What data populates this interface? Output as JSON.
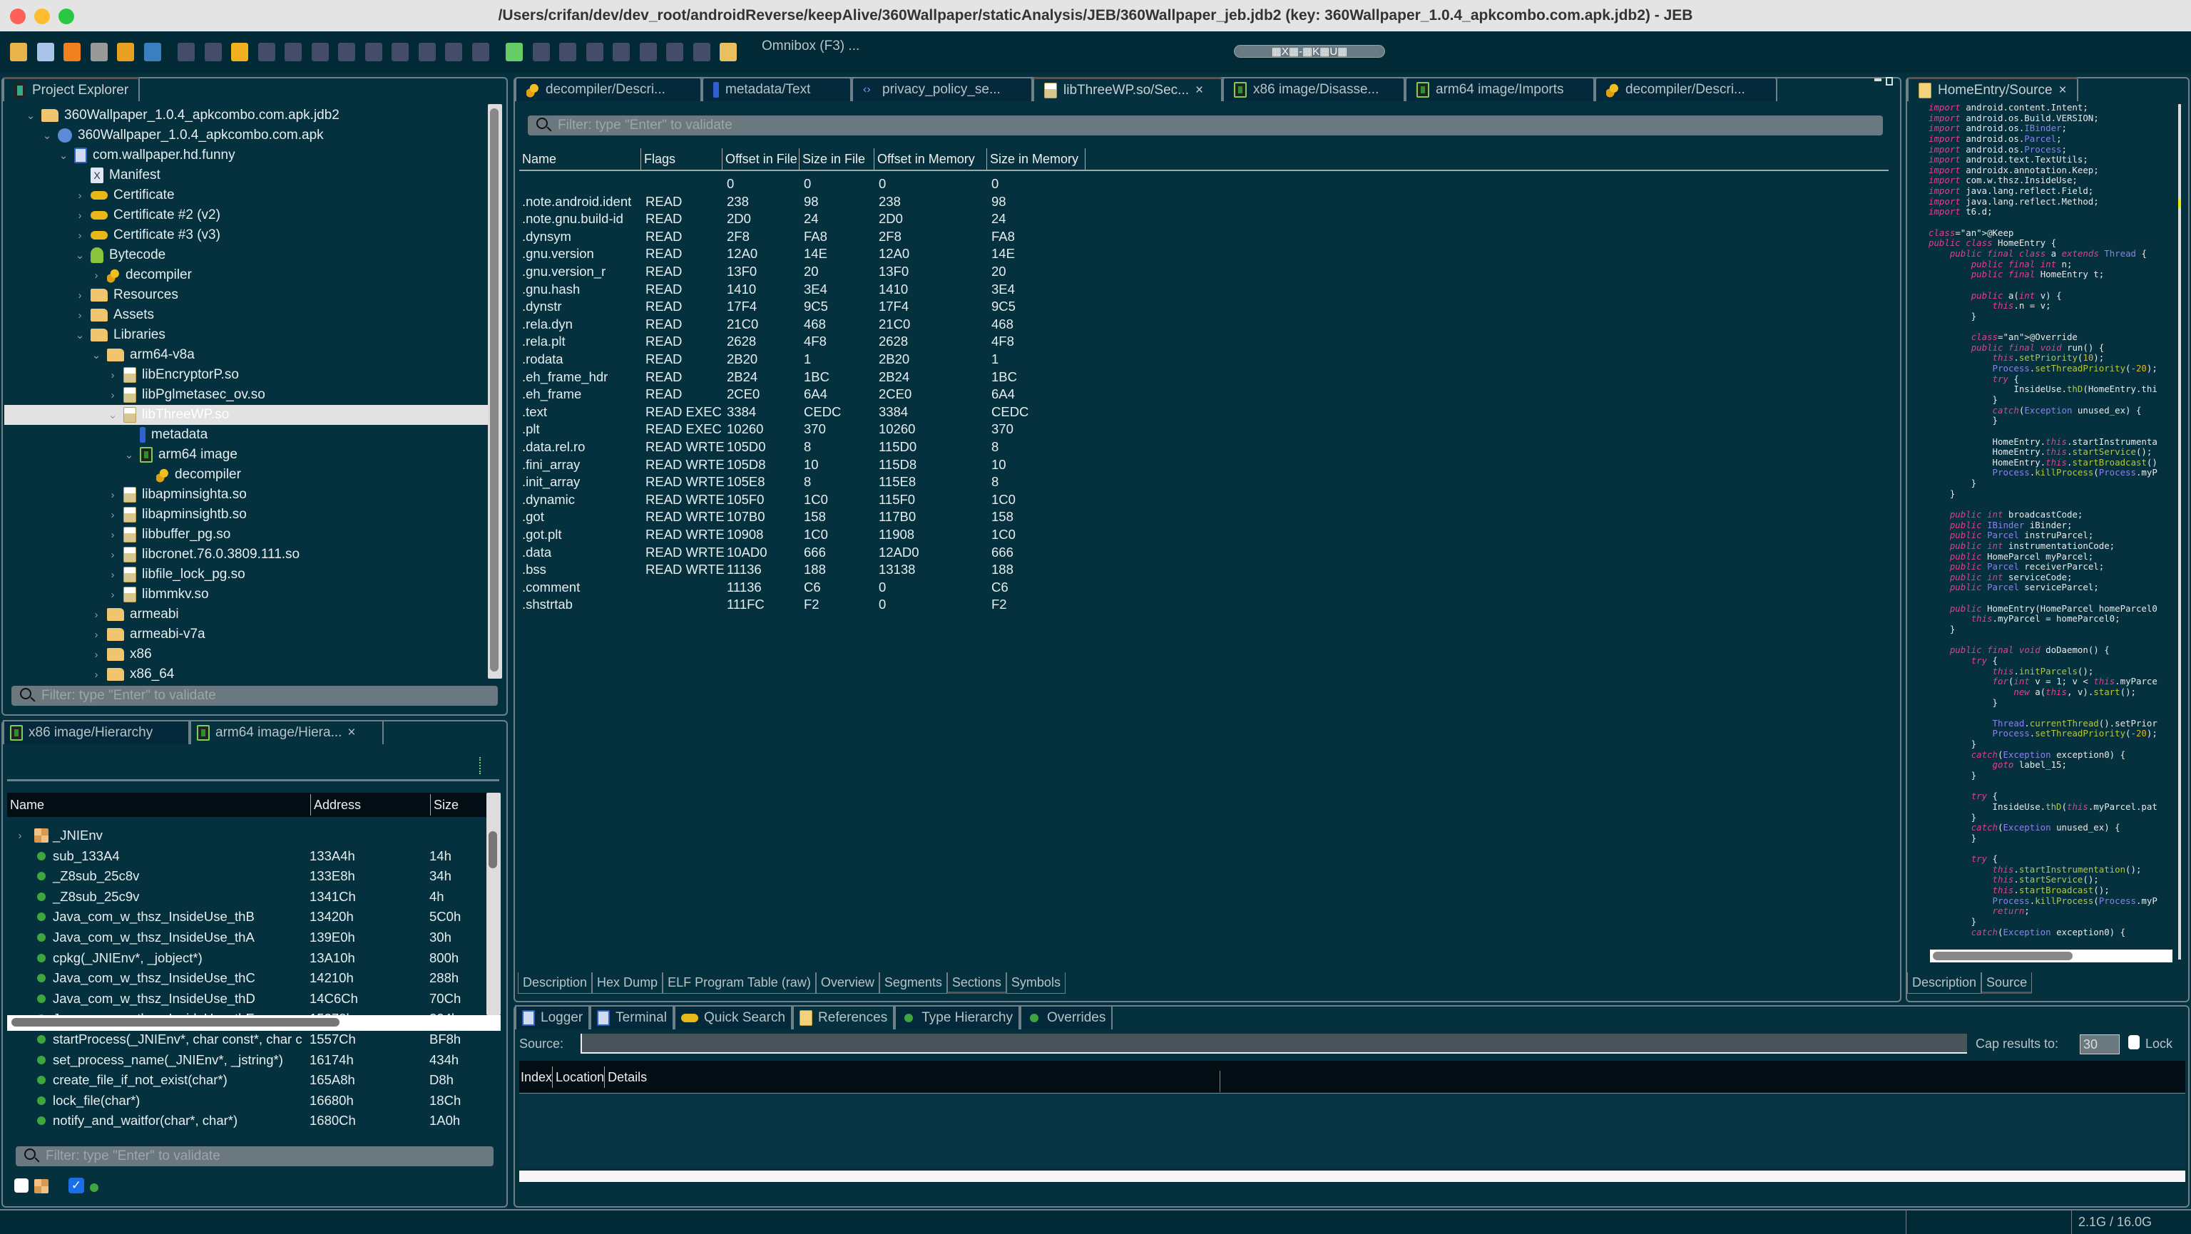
{
  "window": {
    "title": "/Users/crifan/dev/dev_root/androidReverse/keepAlive/360Wallpaper/staticAnalysis/JEB/360Wallpaper_jeb.jdb2 (key: 360Wallpaper_1.0.4_apkcombo.com.apk.jdb2) - JEB"
  },
  "toolbar": {
    "icons": [
      "open-folder-icon",
      "save-icon",
      "wrench-icon",
      "usb-icon",
      "warning-icon",
      "globe-icon",
      "step-into-icon",
      "jump-icon",
      "back-arrow-icon",
      "forward-arrow-icon",
      "gear-icon",
      "comment-icon",
      "pencil-icon",
      "export-icon",
      "grid-icon",
      "blocks-icon",
      "graph-icon",
      "overrides-icon",
      "bug-icon",
      "run-icon",
      "pause-icon",
      "stop-icon",
      "step-over-icon",
      "step-back-icon",
      "step-out-icon",
      "run-to-icon",
      "marker-icon"
    ],
    "omnibox": "Omnibox (F3) ...",
    "shortcut_badge": "▦X▦-▦K▦U▦"
  },
  "project_explorer": {
    "tab": "Project Explorer",
    "filter_placeholder": "Filter: type \"Enter\" to validate",
    "items": [
      {
        "label": "360Wallpaper_1.0.4_apkcombo.com.apk.jdb2",
        "level": 0,
        "chev": "v",
        "icon": "folder"
      },
      {
        "label": "360Wallpaper_1.0.4_apkcombo.com.apk",
        "level": 1,
        "chev": "v",
        "icon": "apk"
      },
      {
        "label": "com.wallpaper.hd.funny",
        "level": 2,
        "chev": "v",
        "icon": "pkg"
      },
      {
        "label": "Manifest",
        "level": 3,
        "chev": "",
        "icon": "manifest"
      },
      {
        "label": "Certificate",
        "level": 3,
        "chev": ">",
        "icon": "key"
      },
      {
        "label": "Certificate #2 (v2)",
        "level": 3,
        "chev": ">",
        "icon": "key"
      },
      {
        "label": "Certificate #3 (v3)",
        "level": 3,
        "chev": ">",
        "icon": "key"
      },
      {
        "label": "Bytecode",
        "level": 3,
        "chev": "v",
        "icon": "android"
      },
      {
        "label": "decompiler",
        "level": 4,
        "chev": ">",
        "icon": "gear"
      },
      {
        "label": "Resources",
        "level": 3,
        "chev": ">",
        "icon": "folder"
      },
      {
        "label": "Assets",
        "level": 3,
        "chev": ">",
        "icon": "folder"
      },
      {
        "label": "Libraries",
        "level": 3,
        "chev": "v",
        "icon": "folder"
      },
      {
        "label": "arm64-v8a",
        "level": 4,
        "chev": "v",
        "icon": "folder"
      },
      {
        "label": "libEncryptorP.so",
        "level": 5,
        "chev": ">",
        "icon": "elf"
      },
      {
        "label": "libPglmetasec_ov.so",
        "level": 5,
        "chev": ">",
        "icon": "elf"
      },
      {
        "label": "libThreeWP.so",
        "level": 5,
        "chev": "v",
        "icon": "elf",
        "selected": true
      },
      {
        "label": "metadata",
        "level": 6,
        "chev": "",
        "icon": "info"
      },
      {
        "label": "arm64 image",
        "level": 6,
        "chev": "v",
        "icon": "chip"
      },
      {
        "label": "decompiler",
        "level": 7,
        "chev": "",
        "icon": "gear"
      },
      {
        "label": "libapminsighta.so",
        "level": 5,
        "chev": ">",
        "icon": "elf"
      },
      {
        "label": "libapminsightb.so",
        "level": 5,
        "chev": ">",
        "icon": "elf"
      },
      {
        "label": "libbuffer_pg.so",
        "level": 5,
        "chev": ">",
        "icon": "elf"
      },
      {
        "label": "libcronet.76.0.3809.111.so",
        "level": 5,
        "chev": ">",
        "icon": "elf"
      },
      {
        "label": "libfile_lock_pg.so",
        "level": 5,
        "chev": ">",
        "icon": "elf"
      },
      {
        "label": "libmmkv.so",
        "level": 5,
        "chev": ">",
        "icon": "elf"
      },
      {
        "label": "armeabi",
        "level": 4,
        "chev": ">",
        "icon": "folder"
      },
      {
        "label": "armeabi-v7a",
        "level": 4,
        "chev": ">",
        "icon": "folder"
      },
      {
        "label": "x86",
        "level": 4,
        "chev": ">",
        "icon": "folder"
      },
      {
        "label": "x86_64",
        "level": 4,
        "chev": ">",
        "icon": "folder"
      }
    ]
  },
  "hierarchy": {
    "tabs": [
      {
        "label": "x86 image/Hierarchy",
        "icon": "chip"
      },
      {
        "label": "arm64 image/Hiera...",
        "icon": "chip",
        "active": true,
        "close": "×"
      }
    ],
    "columns": [
      "Name",
      "Address",
      "Size"
    ],
    "rows": [
      {
        "name": "_JNIEnv",
        "address": "",
        "size": "",
        "icon": "struct",
        "chev": ">"
      },
      {
        "name": "sub_133A4",
        "address": "133A4h",
        "size": "14h",
        "icon": "fn"
      },
      {
        "name": "_Z8sub_25c8v",
        "address": "133E8h",
        "size": "34h",
        "icon": "fn"
      },
      {
        "name": "_Z8sub_25c9v",
        "address": "1341Ch",
        "size": "4h",
        "icon": "fn"
      },
      {
        "name": "Java_com_w_thsz_InsideUse_thB",
        "address": "13420h",
        "size": "5C0h",
        "icon": "fn"
      },
      {
        "name": "Java_com_w_thsz_InsideUse_thA",
        "address": "139E0h",
        "size": "30h",
        "icon": "fn"
      },
      {
        "name": "cpkg(_JNIEnv*, _jobject*)",
        "address": "13A10h",
        "size": "800h",
        "icon": "fn"
      },
      {
        "name": "Java_com_w_thsz_InsideUse_thC",
        "address": "14210h",
        "size": "288h",
        "icon": "fn"
      },
      {
        "name": "Java_com_w_thsz_InsideUse_thD",
        "address": "14C6Ch",
        "size": "70Ch",
        "icon": "fn"
      },
      {
        "name": "Java_com_w_thsz_InsideUse_thE",
        "address": "15378h",
        "size": "204h",
        "icon": "fn"
      },
      {
        "name": "startProcess(_JNIEnv*, char const*, char c",
        "address": "1557Ch",
        "size": "BF8h",
        "icon": "fn"
      },
      {
        "name": "set_process_name(_JNIEnv*, _jstring*)",
        "address": "16174h",
        "size": "434h",
        "icon": "fn"
      },
      {
        "name": "create_file_if_not_exist(char*)",
        "address": "165A8h",
        "size": "D8h",
        "icon": "fn"
      },
      {
        "name": "lock_file(char*)",
        "address": "16680h",
        "size": "18Ch",
        "icon": "fn"
      },
      {
        "name": "notify_and_waitfor(char*, char*)",
        "address": "1680Ch",
        "size": "1A0h",
        "icon": "fn"
      }
    ],
    "filter_placeholder": "Filter: type \"Enter\" to validate",
    "show_types_checked": false,
    "show_functions_checked": true
  },
  "editor": {
    "tabs": [
      {
        "label": "decompiler/Descri...",
        "icon": "gear"
      },
      {
        "label": "metadata/Text",
        "icon": "info"
      },
      {
        "label": "privacy_policy_se...",
        "icon": "code"
      },
      {
        "label": "libThreeWP.so/Sec...",
        "icon": "elf",
        "active": true,
        "close": "×"
      },
      {
        "label": "x86 image/Disasse...",
        "icon": "chip"
      },
      {
        "label": "arm64 image/Imports",
        "icon": "chip"
      },
      {
        "label": "decompiler/Descri...",
        "icon": "gear"
      }
    ],
    "filter_placeholder": "Filter: type \"Enter\" to validate",
    "sections": {
      "columns": [
        "Name",
        "Flags",
        "Offset in File",
        "Size in File",
        "Offset in Memory",
        "Size in Memory"
      ],
      "rows": [
        [
          "",
          "",
          "0",
          "0",
          "0",
          "0"
        ],
        [
          ".note.android.ident",
          "READ",
          "238",
          "98",
          "238",
          "98"
        ],
        [
          ".note.gnu.build-id",
          "READ",
          "2D0",
          "24",
          "2D0",
          "24"
        ],
        [
          ".dynsym",
          "READ",
          "2F8",
          "FA8",
          "2F8",
          "FA8"
        ],
        [
          ".gnu.version",
          "READ",
          "12A0",
          "14E",
          "12A0",
          "14E"
        ],
        [
          ".gnu.version_r",
          "READ",
          "13F0",
          "20",
          "13F0",
          "20"
        ],
        [
          ".gnu.hash",
          "READ",
          "1410",
          "3E4",
          "1410",
          "3E4"
        ],
        [
          ".dynstr",
          "READ",
          "17F4",
          "9C5",
          "17F4",
          "9C5"
        ],
        [
          ".rela.dyn",
          "READ",
          "21C0",
          "468",
          "21C0",
          "468"
        ],
        [
          ".rela.plt",
          "READ",
          "2628",
          "4F8",
          "2628",
          "4F8"
        ],
        [
          ".rodata",
          "READ",
          "2B20",
          "1",
          "2B20",
          "1"
        ],
        [
          ".eh_frame_hdr",
          "READ",
          "2B24",
          "1BC",
          "2B24",
          "1BC"
        ],
        [
          ".eh_frame",
          "READ",
          "2CE0",
          "6A4",
          "2CE0",
          "6A4"
        ],
        [
          ".text",
          "READ EXEC",
          "3384",
          "CEDC",
          "3384",
          "CEDC"
        ],
        [
          ".plt",
          "READ EXEC",
          "10260",
          "370",
          "10260",
          "370"
        ],
        [
          ".data.rel.ro",
          "READ WRTE",
          "105D0",
          "8",
          "115D0",
          "8"
        ],
        [
          ".fini_array",
          "READ WRTE",
          "105D8",
          "10",
          "115D8",
          "10"
        ],
        [
          ".init_array",
          "READ WRTE",
          "105E8",
          "8",
          "115E8",
          "8"
        ],
        [
          ".dynamic",
          "READ WRTE",
          "105F0",
          "1C0",
          "115F0",
          "1C0"
        ],
        [
          ".got",
          "READ WRTE",
          "107B0",
          "158",
          "117B0",
          "158"
        ],
        [
          ".got.plt",
          "READ WRTE",
          "10908",
          "1C0",
          "11908",
          "1C0"
        ],
        [
          ".data",
          "READ WRTE",
          "10AD0",
          "666",
          "12AD0",
          "666"
        ],
        [
          ".bss",
          "READ WRTE",
          "11136",
          "188",
          "13138",
          "188"
        ],
        [
          ".comment",
          "",
          "11136",
          "C6",
          "0",
          "C6"
        ],
        [
          ".shstrtab",
          "",
          "111FC",
          "F2",
          "0",
          "F2"
        ]
      ]
    },
    "bottom_tabs": [
      {
        "label": "Description"
      },
      {
        "label": "Hex Dump"
      },
      {
        "label": "ELF Program Table (raw)"
      },
      {
        "label": "Overview"
      },
      {
        "label": "Segments"
      },
      {
        "label": "Sections",
        "active": true
      },
      {
        "label": "Symbols"
      }
    ]
  },
  "source": {
    "tab": "HomeEntry/Source",
    "close": "×",
    "lines": [
      "import android.content.Intent;",
      "import android.os.Build.VERSION;",
      "import android.os.IBinder;",
      "import android.os.Parcel;",
      "import android.os.Process;",
      "import android.text.TextUtils;",
      "import androidx.annotation.Keep;",
      "import com.w.thsz.InsideUse;",
      "import java.lang.reflect.Field;",
      "import java.lang.reflect.Method;",
      "import t6.d;",
      "",
      "@Keep",
      "public class HomeEntry {",
      "    public final class a extends Thread {",
      "        public final int n;",
      "        public final HomeEntry t;",
      "",
      "        public a(int v) {",
      "            this.n = v;",
      "        }",
      "",
      "        @Override",
      "        public final void run() {",
      "            this.setPriority(10);",
      "            Process.setThreadPriority(-20);",
      "            try {",
      "                InsideUse.thD(HomeEntry.thi",
      "            }",
      "            catch(Exception unused_ex) {",
      "            }",
      "",
      "            HomeEntry.this.startInstrumenta",
      "            HomeEntry.this.startService();",
      "            HomeEntry.this.startBroadcast()",
      "            Process.killProcess(Process.myP",
      "        }",
      "    }",
      "",
      "    public int broadcastCode;",
      "    public IBinder iBinder;",
      "    public Parcel instruParcel;",
      "    public int instrumentationCode;",
      "    public HomeParcel myParcel;",
      "    public Parcel receiverParcel;",
      "    public int serviceCode;",
      "    public Parcel serviceParcel;",
      "",
      "    public HomeEntry(HomeParcel homeParcel0",
      "        this.myParcel = homeParcel0;",
      "    }",
      "",
      "    public final void doDaemon() {",
      "        try {",
      "            this.initParcels();",
      "            for(int v = 1; v < this.myParce",
      "                new a(this, v).start();",
      "            }",
      "",
      "            Thread.currentThread().setPrior",
      "            Process.setThreadPriority(-20);",
      "        }",
      "        catch(Exception exception0) {",
      "            goto label_15;",
      "        }",
      "",
      "        try {",
      "            InsideUse.thD(this.myParcel.pat",
      "        }",
      "        catch(Exception unused_ex) {",
      "        }",
      "",
      "        try {",
      "            this.startInstrumentation();",
      "            this.startService();",
      "            this.startBroadcast();",
      "            Process.killProcess(Process.myP",
      "            return;",
      "        }",
      "        catch(Exception exception0) {"
    ],
    "bottom_tabs": [
      {
        "label": "Description"
      },
      {
        "label": "Source",
        "active": true
      }
    ]
  },
  "console": {
    "tabs": [
      {
        "label": "Logger",
        "icon": "monitor"
      },
      {
        "label": "Terminal",
        "icon": "terminal"
      },
      {
        "label": "Quick Search",
        "icon": "marker"
      },
      {
        "label": "References",
        "icon": "references",
        "active": true
      },
      {
        "label": "Type Hierarchy",
        "icon": "hierarchy"
      },
      {
        "label": "Overrides",
        "icon": "overrides"
      }
    ],
    "source_label": "Source:",
    "source_value": "",
    "cap_label": "Cap results to:",
    "cap_value": "30",
    "lock_label": "Lock",
    "lock_checked": false,
    "columns": [
      "Index",
      "Location",
      "Details"
    ]
  },
  "status": {
    "memory": "2.1G / 16.0G"
  },
  "colors": {
    "background": "#05303e",
    "toolbar": "#022a36",
    "keyword": "#e0408a",
    "type": "#8a80f0",
    "method": "#b3c840"
  }
}
